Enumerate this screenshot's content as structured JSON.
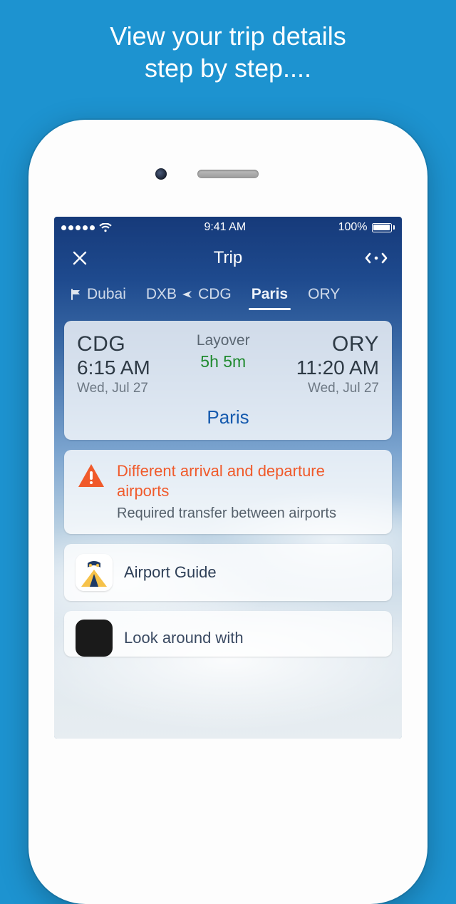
{
  "promo": {
    "line1": "View your trip details",
    "line2": "step by step...."
  },
  "statusbar": {
    "time": "9:41 AM",
    "battery_pct": "100%"
  },
  "nav": {
    "title": "Trip"
  },
  "tabs": {
    "items": [
      {
        "label": "Dubai",
        "kind": "city-with-flag"
      },
      {
        "label": "DXB ✈ CDG",
        "kind": "flight",
        "from": "DXB",
        "to": "CDG"
      },
      {
        "label": "Paris",
        "kind": "city",
        "active": true
      },
      {
        "label": "ORY",
        "kind": "airport-partial"
      }
    ]
  },
  "layover": {
    "arrive_code": "CDG",
    "arrive_time": "6:15 AM",
    "arrive_date": "Wed, Jul 27",
    "label": "Layover",
    "duration": "5h 5m",
    "depart_code": "ORY",
    "depart_time": "11:20 AM",
    "depart_date": "Wed, Jul 27",
    "city": "Paris"
  },
  "warning": {
    "title": "Different arrival and departure airports",
    "subtitle": "Required transfer between airports"
  },
  "guide": {
    "label": "Airport Guide"
  },
  "peek": {
    "label": "Look around with"
  }
}
